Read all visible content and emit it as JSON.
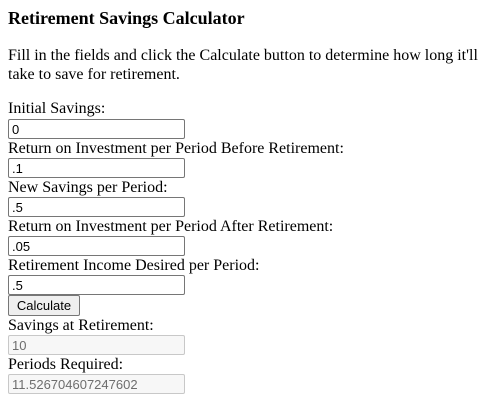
{
  "title": "Retirement Savings Calculator",
  "intro": "Fill in the fields and click the Calculate button to determine how long it'll take to save for retirement.",
  "fields": {
    "initial_savings": {
      "label": "Initial Savings:",
      "value": "0"
    },
    "roi_before": {
      "label": "Return on Investment per Period Before Retirement:",
      "value": ".1"
    },
    "new_savings": {
      "label": "New Savings per Period:",
      "value": ".5"
    },
    "roi_after": {
      "label": "Return on Investment per Period After Retirement:",
      "value": ".05"
    },
    "income_desired": {
      "label": "Retirement Income Desired per Period:",
      "value": ".5"
    }
  },
  "calculate_label": "Calculate",
  "results": {
    "savings_at_retirement": {
      "label": "Savings at Retirement:",
      "value": "10"
    },
    "periods_required": {
      "label": "Periods Required:",
      "value": "11.526704607247602"
    }
  }
}
